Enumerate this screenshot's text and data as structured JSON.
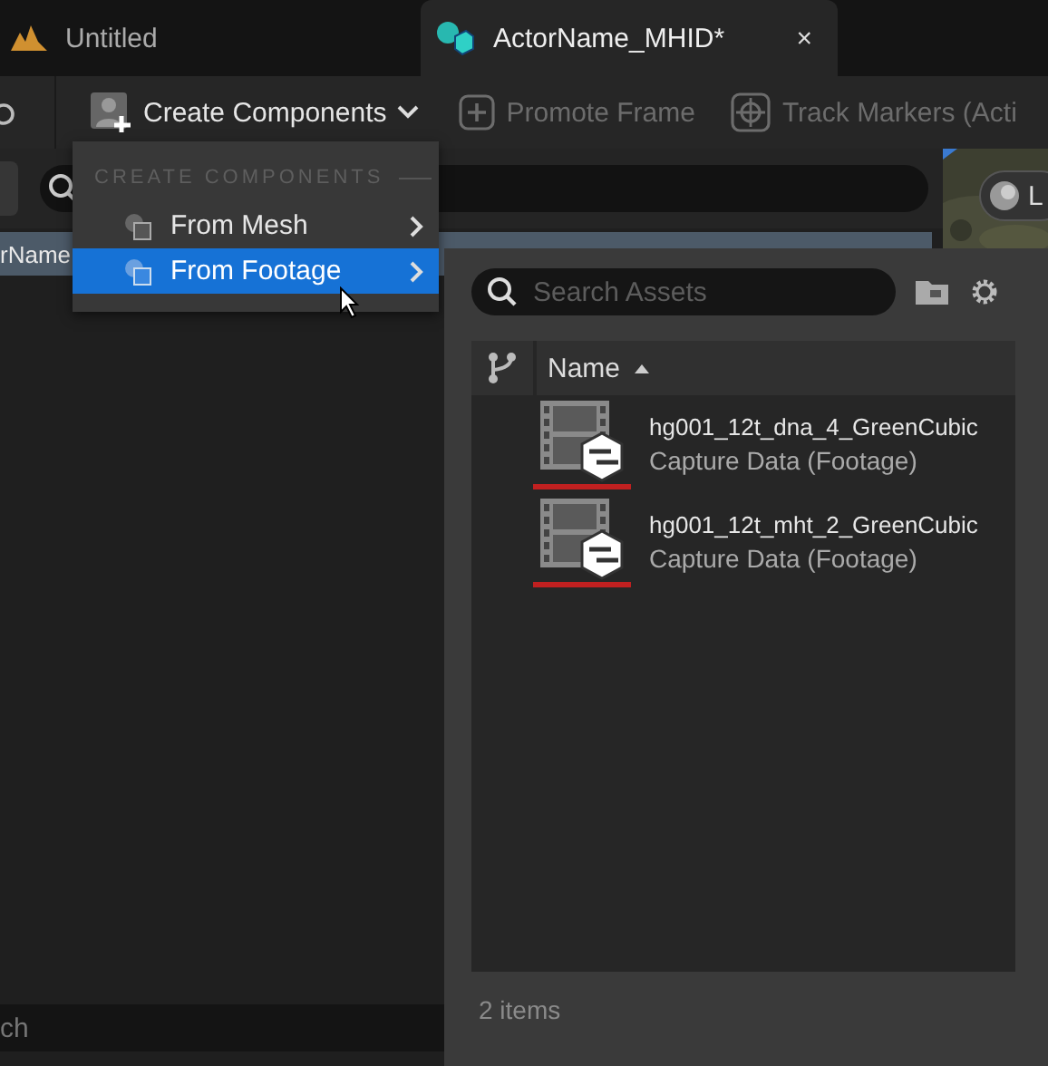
{
  "tabs": [
    {
      "label": "Untitled",
      "selected": false,
      "kind": "level"
    },
    {
      "label": "ActorName_MHID*",
      "selected": true,
      "kind": "metahuman"
    }
  ],
  "tab_close": "×",
  "toolbar": [
    {
      "label": "Create Components",
      "kind": "dropdown",
      "disabled": false
    },
    {
      "label": "Promote Frame",
      "kind": "plus",
      "disabled": true
    },
    {
      "label": "Track Markers (Acti",
      "kind": "target",
      "disabled": true
    }
  ],
  "outliner": {
    "row": "rName",
    "bottom_search_placeholder": "ch"
  },
  "viewport": {
    "button": "L"
  },
  "menu": {
    "header": "CREATE COMPONENTS",
    "items": [
      {
        "label": "From Mesh",
        "selected": false
      },
      {
        "label": "From Footage",
        "selected": true
      }
    ]
  },
  "asset_picker": {
    "search_placeholder": "Search Assets",
    "column": "Name",
    "rows": [
      {
        "name": "hg001_12t_dna_4_GreenCubic",
        "type": "Capture Data (Footage)"
      },
      {
        "name": "hg001_12t_mht_2_GreenCubic",
        "type": "Capture Data (Footage)"
      }
    ],
    "count": "2 items"
  }
}
